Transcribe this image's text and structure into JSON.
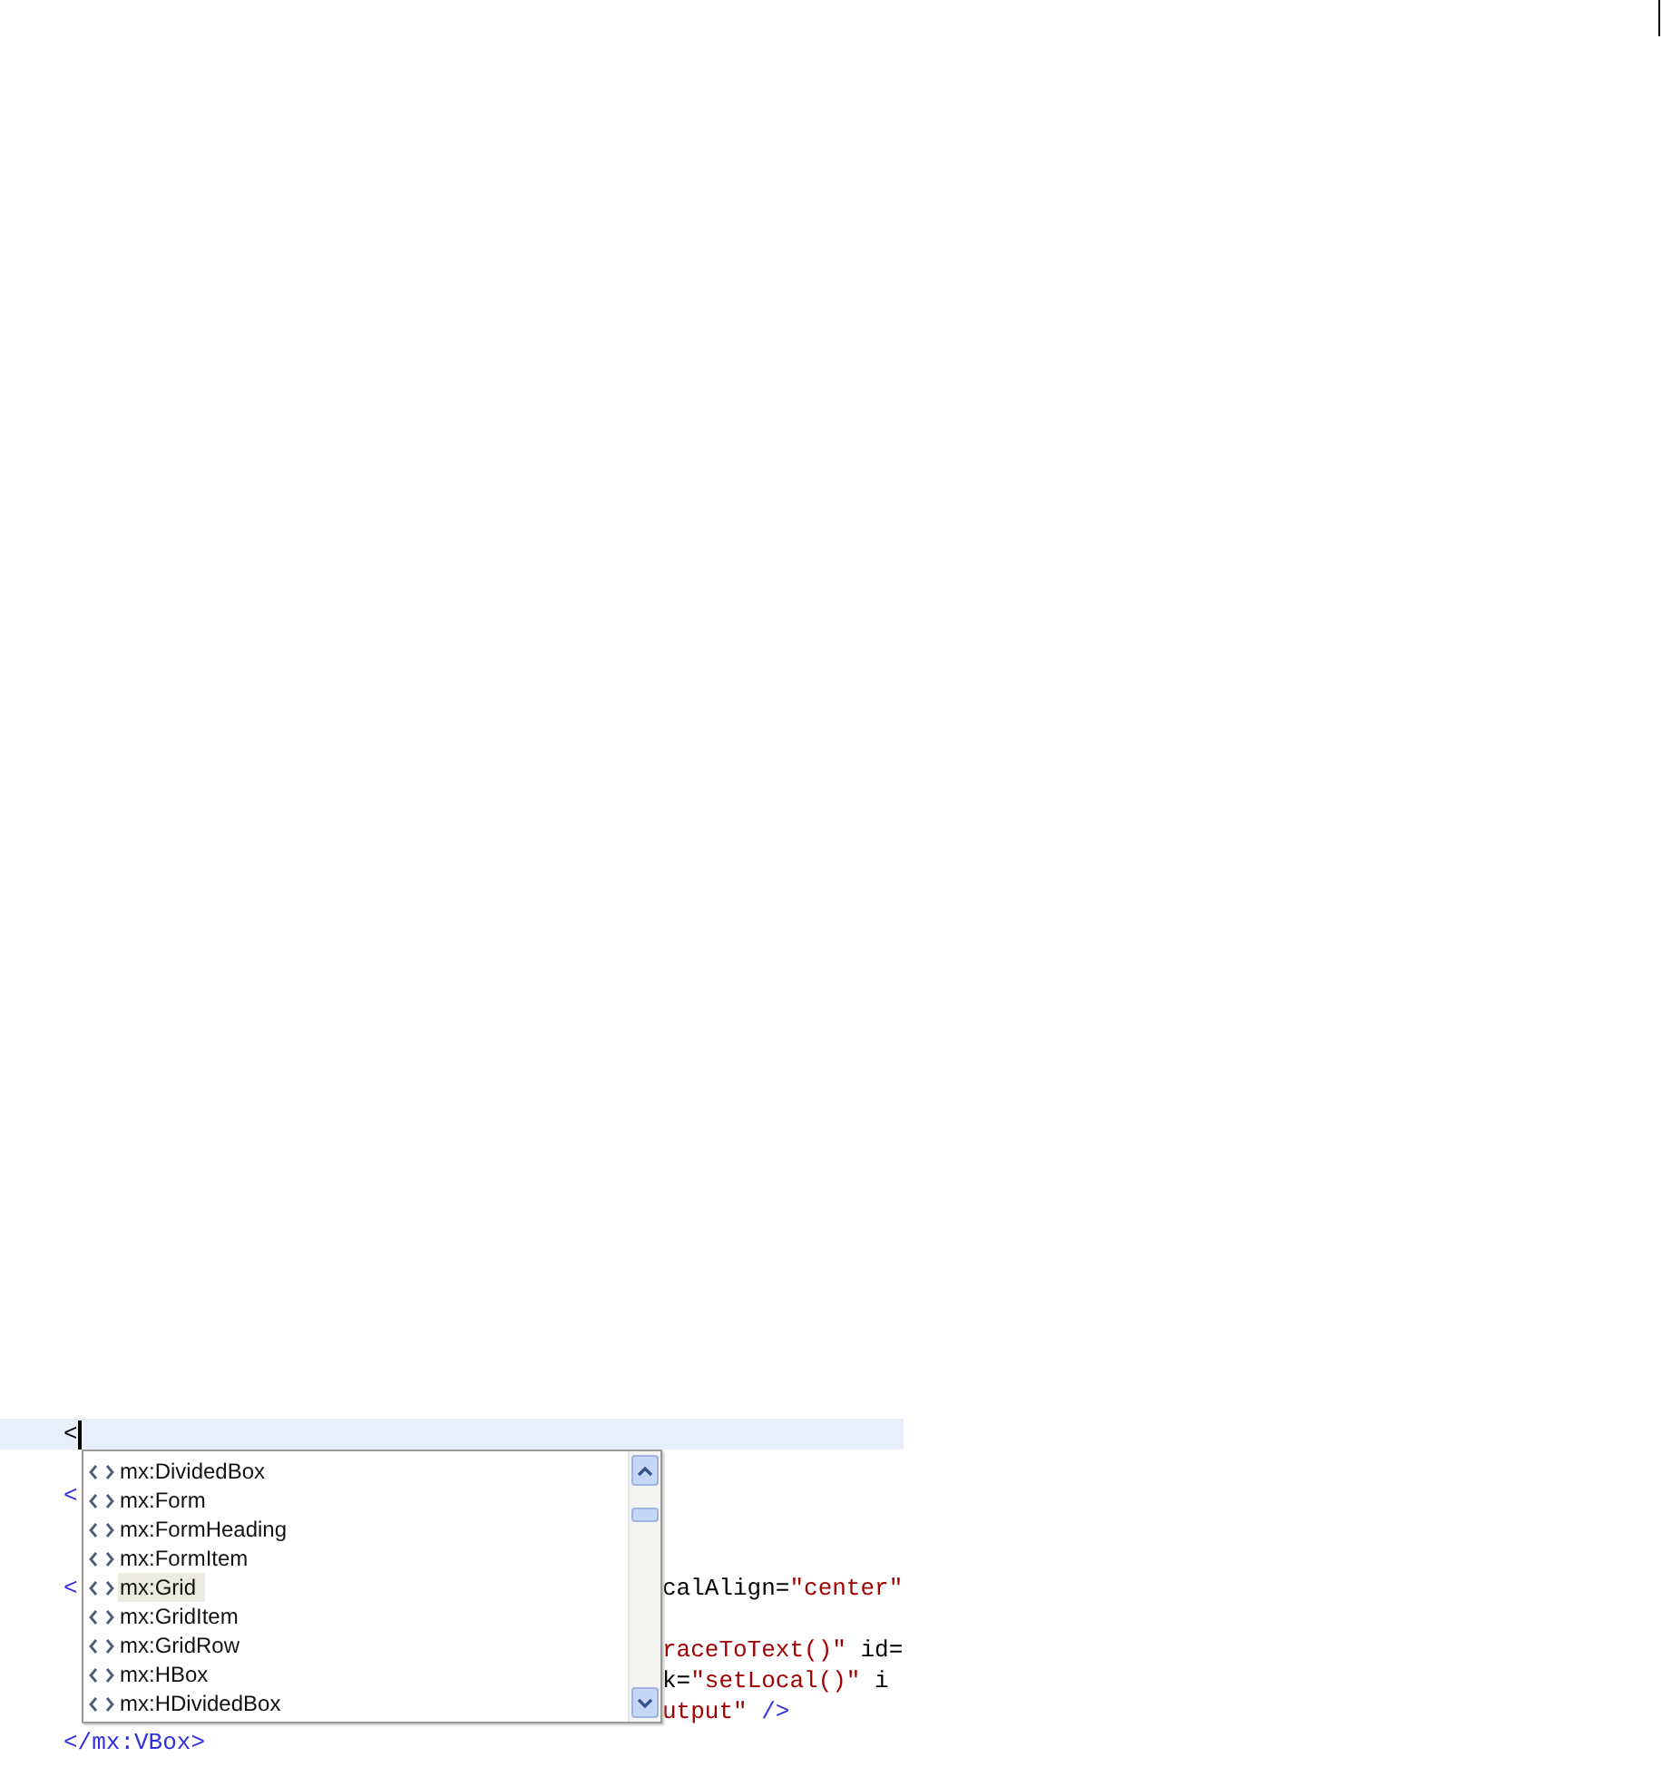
{
  "editor": {
    "lines": [
      {
        "current": true,
        "left": [
          {
            "kind": "plain",
            "text": "<"
          }
        ],
        "cursor": true
      },
      {
        "current": false
      },
      {
        "current": false,
        "left": [
          {
            "kind": "tag",
            "text": "<"
          }
        ]
      },
      {
        "current": false
      },
      {
        "current": false
      },
      {
        "current": false,
        "left": [
          {
            "kind": "tag",
            "text": "<"
          }
        ],
        "right": [
          {
            "kind": "attr",
            "text": "calAlign="
          },
          {
            "kind": "value",
            "text": "\"center\""
          }
        ]
      },
      {
        "current": false
      },
      {
        "current": false,
        "right": [
          {
            "kind": "value",
            "text": "raceToText()\""
          },
          {
            "kind": "attr",
            "text": " id="
          }
        ]
      },
      {
        "current": false,
        "right": [
          {
            "kind": "attr",
            "text": "k="
          },
          {
            "kind": "value",
            "text": "\"setLocal()\""
          },
          {
            "kind": "attr",
            "text": " i"
          }
        ]
      },
      {
        "current": false,
        "right": [
          {
            "kind": "value",
            "text": "utput\""
          },
          {
            "kind": "tag",
            "text": " />"
          }
        ]
      },
      {
        "current": false,
        "left": [
          {
            "kind": "tag",
            "text": "</mx:VBox>"
          }
        ]
      }
    ]
  },
  "completion_popup": {
    "items": [
      {
        "label": "mx:DividedBox",
        "selected": false
      },
      {
        "label": "mx:Form",
        "selected": false
      },
      {
        "label": "mx:FormHeading",
        "selected": false
      },
      {
        "label": "mx:FormItem",
        "selected": false
      },
      {
        "label": "mx:Grid",
        "selected": true
      },
      {
        "label": "mx:GridItem",
        "selected": false
      },
      {
        "label": "mx:GridRow",
        "selected": false
      },
      {
        "label": "mx:HBox",
        "selected": false
      },
      {
        "label": "mx:HDividedBox",
        "selected": false
      }
    ]
  }
}
